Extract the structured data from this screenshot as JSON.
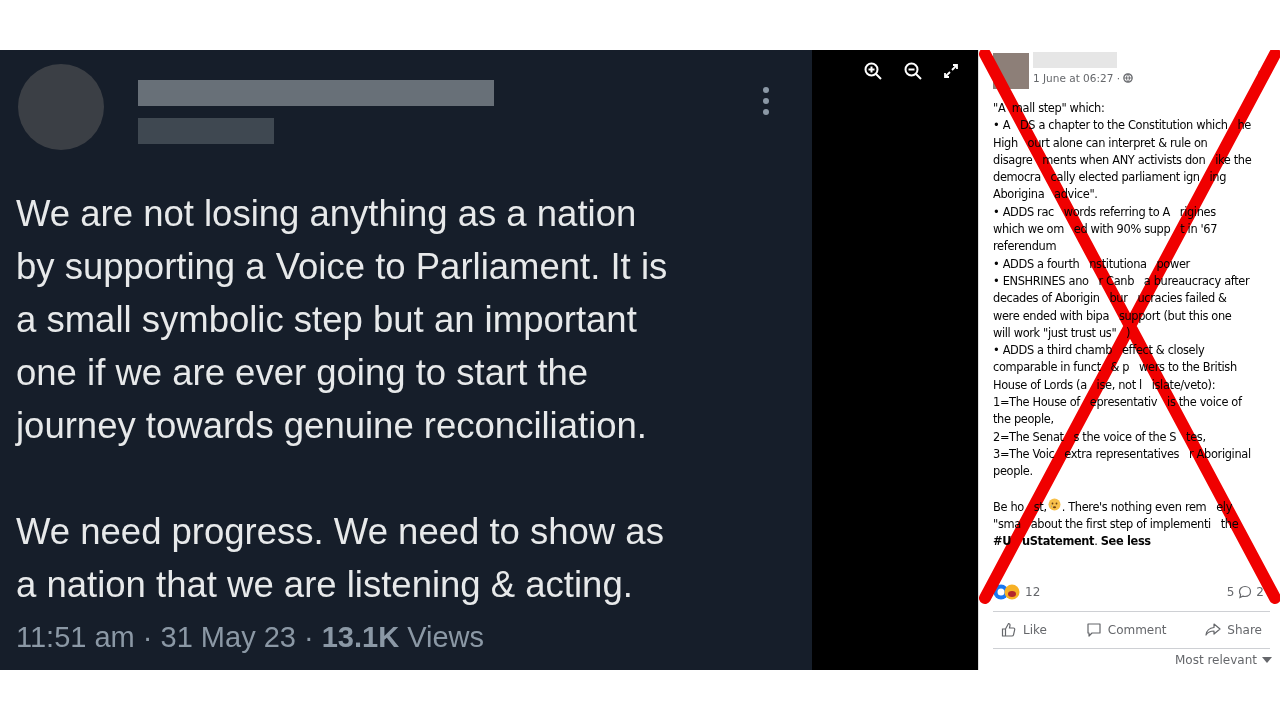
{
  "tweet": {
    "paragraphs": [
      [
        "We are not losing anything as a nation",
        "by supporting a Voice to Parliament. It is",
        "a small symbolic step but an important",
        "one if we are ever going to start the",
        "journey towards genuine reconciliation."
      ],
      [
        "We need progress. We need to show as",
        "a nation that we are listening & acting."
      ]
    ],
    "meta": "11:51 am · 31 May 23 · **13.1K** Views"
  },
  "facebook_post": {
    "timestamp": "1 June at 06:27 ·",
    "lines": [
      {
        "kind": "text",
        "text": "\"A  mall step\" which:"
      },
      {
        "kind": "text",
        "text": "• A   DS a chapter to the Constitution which   he"
      },
      {
        "kind": "text",
        "text": "High   ourt alone can interpret & rule on"
      },
      {
        "kind": "text",
        "text": "disagre   ments when ANY activists don   ike the"
      },
      {
        "kind": "text",
        "text": "democra   cally elected parliament ign   ing"
      },
      {
        "kind": "text",
        "text": "Aborigina   advice\"."
      },
      {
        "kind": "text",
        "text": "• ADDS rac   words referring to A   rigines"
      },
      {
        "kind": "text",
        "text": "which we om   ed with 90% supp   t in '67"
      },
      {
        "kind": "text",
        "text": "referendum"
      },
      {
        "kind": "text",
        "text": "• ADDS a fourth   nstitutiona   power"
      },
      {
        "kind": "text",
        "text": "• ENSHRINES ano   r Canb   a bureaucracy after"
      },
      {
        "kind": "text",
        "text": "decades of Aborigin   bur   ucracies failed &"
      },
      {
        "kind": "text",
        "text": "were ended with bipa   support (but this one"
      },
      {
        "kind": "text",
        "text": "will work \"just trust us\"   )"
      },
      {
        "kind": "text",
        "text": "• ADDS a third chamb   effect & closely"
      },
      {
        "kind": "text",
        "text": "comparable in funct   & p   wers to the British"
      },
      {
        "kind": "text",
        "text": "House of Lords (a   ise, not l   islate/veto):"
      },
      {
        "kind": "text",
        "text": "1=The House of   epresentativ   is the voice of"
      },
      {
        "kind": "text",
        "text": "the people,"
      },
      {
        "kind": "text",
        "text": "2=The Senat   s the voice of the S   tes,"
      },
      {
        "kind": "text",
        "text": "3=The Voic   extra representatives   r Aboriginal"
      },
      {
        "kind": "text",
        "text": "people."
      },
      {
        "kind": "gap"
      },
      {
        "kind": "emoji",
        "before": "Be ho   st,",
        "after": ". There's nothing even rem   ely"
      },
      {
        "kind": "text",
        "text": "\"sma   about the first step of implementi   the"
      },
      {
        "kind": "text",
        "text": "**#U   uStatement**. **See less**"
      }
    ],
    "reaction_count": "12",
    "comment_count": "5",
    "share_count": "2",
    "actions": [
      {
        "kind": "like",
        "label": "Like"
      },
      {
        "kind": "comment",
        "label": "Comment"
      },
      {
        "kind": "share",
        "label": "Share"
      }
    ],
    "sort": "Most relevant"
  }
}
